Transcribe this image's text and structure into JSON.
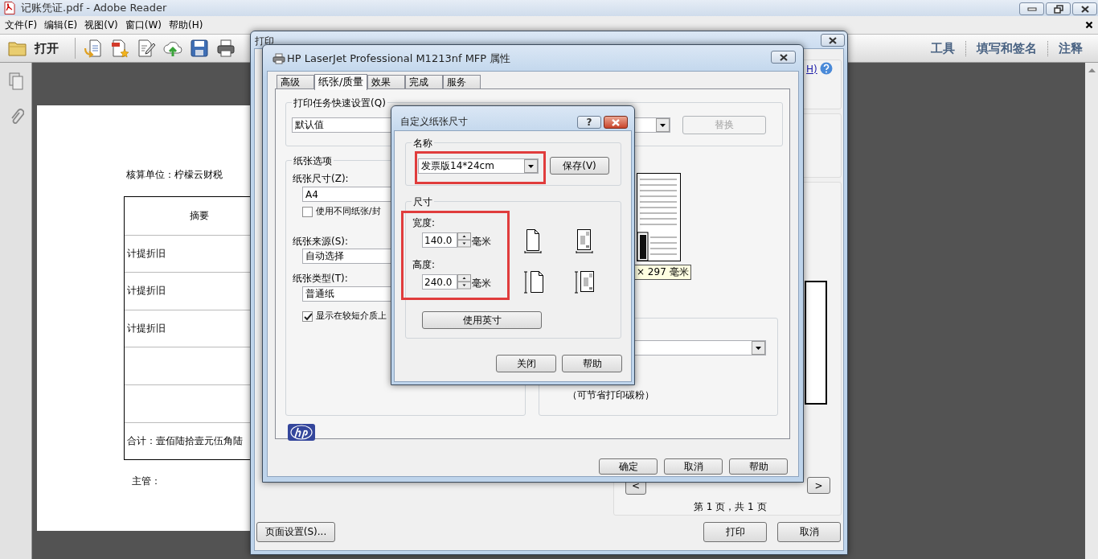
{
  "reader": {
    "title": "记账凭证.pdf - Adobe Reader",
    "menu": [
      "文件(F)",
      "编辑(E)",
      "视图(V)",
      "窗口(W)",
      "帮助(H)"
    ],
    "open_button": "打开",
    "tool_tabs": [
      "工具",
      "填写和签名",
      "注释"
    ],
    "document": {
      "unit_line": "核算单位：柠檬云财税",
      "header": "摘要",
      "rows": [
        "计提折旧",
        "计提折旧",
        "计提折旧"
      ],
      "total": "合计：壹佰陆拾壹元伍角陆",
      "signer": "主管："
    }
  },
  "print_dialog": {
    "title": "打印",
    "help_link": "H)",
    "prev_button": "<",
    "next_button": ">",
    "page_info": "第 1 页，共 1 页",
    "page_setup_button": "页面设置(S)...",
    "print_button": "打印",
    "cancel_button": "取消"
  },
  "properties_dialog": {
    "title": "HP LaserJet Professional M1213nf MFP 属性",
    "tabs": [
      {
        "label": "高级",
        "selected": false
      },
      {
        "label": "纸张/质量",
        "selected": true
      },
      {
        "label": "效果",
        "selected": false
      },
      {
        "label": "完成",
        "selected": false
      },
      {
        "label": "服务",
        "selected": false
      }
    ],
    "quick_settings": {
      "label": "打印任务快速设置(Q)",
      "value": "默认值",
      "replace_button": "替换",
      "replace_disabled": true
    },
    "paper_options": {
      "label": "纸张选项",
      "size_label": "纸张尺寸(Z):",
      "size_value": "A4",
      "different_paper": {
        "label": "使用不同纸张/封",
        "checked": false
      },
      "source_label": "纸张来源(S):",
      "source_value": "自动选择",
      "type_label": "纸张类型(T):",
      "type_value": "普通纸",
      "show_short": {
        "label": "显示在较短介质上",
        "checked": true
      }
    },
    "preview_size": "× 297 毫米",
    "toner_note": "（可节省打印碳粉）",
    "buttons": [
      "确定",
      "取消",
      "帮助"
    ]
  },
  "custom_size_dialog": {
    "title": "自定义纸张尺寸",
    "help_button": "?",
    "name_group": "名称",
    "name_value": "发票版14*24cm",
    "save_button": "保存(V)",
    "size_group": "尺寸",
    "width_label": "宽度:",
    "width_value": "140.0",
    "width_unit": "毫米",
    "height_label": "高度:",
    "height_value": "240.0",
    "height_unit": "毫米",
    "inches_button": "使用英寸",
    "buttons": [
      "关闭",
      "帮助"
    ]
  }
}
